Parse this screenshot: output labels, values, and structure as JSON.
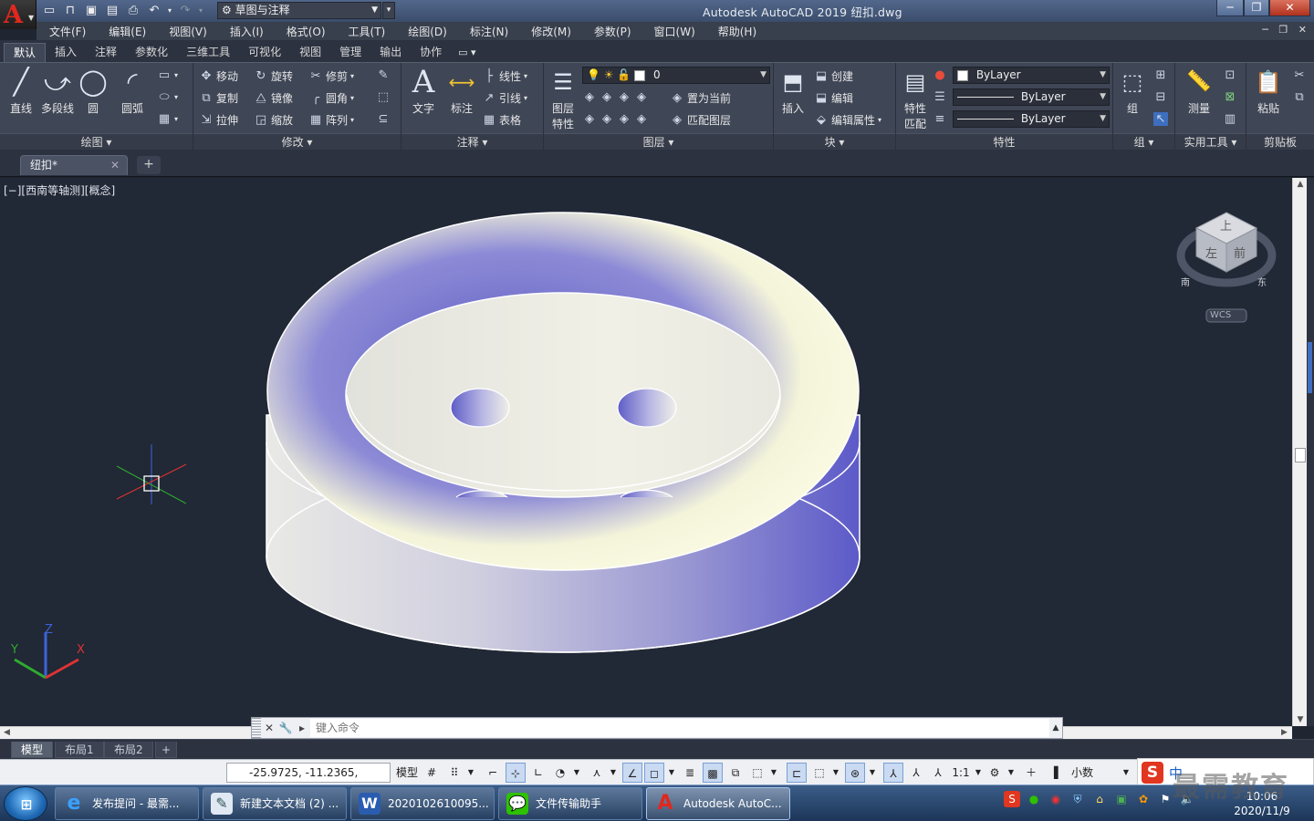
{
  "titlebar": {
    "workspace": "草图与注释",
    "title": "Autodesk AutoCAD 2019    纽扣.dwg",
    "logo_letter": "A"
  },
  "menu": [
    "文件(F)",
    "编辑(E)",
    "视图(V)",
    "插入(I)",
    "格式(O)",
    "工具(T)",
    "绘图(D)",
    "标注(N)",
    "修改(M)",
    "参数(P)",
    "窗口(W)",
    "帮助(H)"
  ],
  "ribbon_tabs": [
    "默认",
    "插入",
    "注释",
    "参数化",
    "三维工具",
    "可视化",
    "视图",
    "管理",
    "输出",
    "协作"
  ],
  "ribbon_tab_extra": "▭ ▾",
  "panels": {
    "draw": {
      "title": "绘图 ▾",
      "line": "直线",
      "polyline": "多段线",
      "circle": "圆",
      "arc": "圆弧"
    },
    "modify": {
      "title": "修改 ▾",
      "move": "移动",
      "rotate": "旋转",
      "trim": "修剪",
      "copy": "复制",
      "mirror": "镜像",
      "fillet": "圆角",
      "stretch": "拉伸",
      "scale": "缩放",
      "array": "阵列"
    },
    "annotation": {
      "title": "注释 ▾",
      "text": "文字",
      "dimension": "标注",
      "linear": "线性",
      "leader": "引线",
      "table": "表格"
    },
    "layers": {
      "title": "图层 ▾",
      "layer_props_1": "图层",
      "layer_props_2": "特性",
      "layer_value": "0",
      "set_current": "置为当前",
      "match_layer": "匹配图层"
    },
    "block": {
      "title": "块 ▾",
      "insert": "插入",
      "create": "创建",
      "edit": "编辑",
      "edit_attr": "编辑属性"
    },
    "properties": {
      "title": "特性",
      "match_1": "特性",
      "match_2": "匹配",
      "color": "ByLayer",
      "linetype": "ByLayer",
      "lineweight": "ByLayer"
    },
    "groups": {
      "title": "组 ▾",
      "group": "组"
    },
    "utilities": {
      "title": "实用工具 ▾",
      "measure": "测量"
    },
    "clipboard": {
      "title": "剪贴板",
      "paste": "粘贴"
    }
  },
  "file_tab": {
    "name": "纽扣*"
  },
  "viewport": {
    "label": "[−][西南等轴测][概念]"
  },
  "viewcube": {
    "top": "上",
    "front": "前",
    "left": "左",
    "wcs": "WCS",
    "south": "南",
    "east": "东"
  },
  "ucs": {
    "x": "X",
    "y": "Y",
    "z": "Z"
  },
  "command": {
    "placeholder": "键入命令"
  },
  "layout_tabs": [
    "模型",
    "布局1",
    "布局2"
  ],
  "status": {
    "coords": "-25.9725, -11.2365, 0.0000",
    "model": "模型",
    "scale": "1:1",
    "units": "小数"
  },
  "taskbar": {
    "items": [
      "发布提问 - 最需...",
      "新建文本文档 (2) ...",
      "2020102610095...",
      "文件传输助手",
      "Autodesk AutoC..."
    ],
    "time": "10:06",
    "date": "2020/11/9"
  },
  "ime": {
    "label": "中"
  },
  "watermark": "最需教育",
  "colors": {
    "title_bg": "#4a5f82",
    "viewport_bg": "#212836",
    "ribbon_bg": "#3f4656",
    "accent": "#3e6fbf",
    "close": "#c8462f"
  }
}
